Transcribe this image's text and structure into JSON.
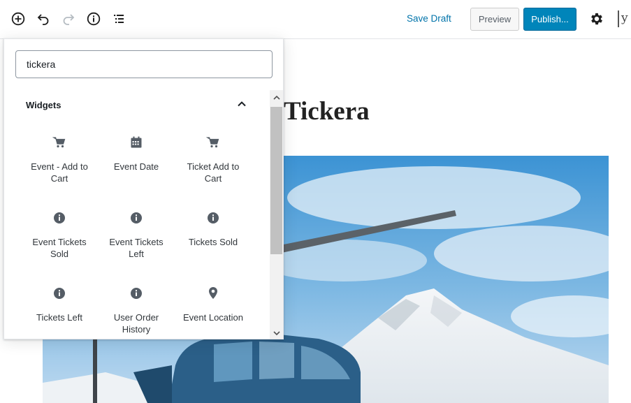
{
  "toolbar": {
    "add_block_icon": "plus-circle-icon",
    "undo_icon": "undo-icon",
    "redo_icon": "redo-icon",
    "info_icon": "info-icon",
    "outline_icon": "list-view-icon",
    "save_draft": "Save Draft",
    "preview": "Preview",
    "publish": "Publish...",
    "settings_icon": "gear-icon",
    "yoast_icon": "yoast-icon",
    "yoast_glyph": "y"
  },
  "editor": {
    "title": "Tickera"
  },
  "inserter": {
    "search_value": "tickera",
    "section_title": "Widgets",
    "items": [
      {
        "label": "Event - Add to Cart",
        "icon": "cart-icon"
      },
      {
        "label": "Event Date",
        "icon": "calendar-icon"
      },
      {
        "label": "Ticket Add to Cart",
        "icon": "cart-icon"
      },
      {
        "label": "Event Tickets Sold",
        "icon": "info-icon"
      },
      {
        "label": "Event Tickets Left",
        "icon": "info-icon"
      },
      {
        "label": "Tickets Sold",
        "icon": "info-icon"
      },
      {
        "label": "Tickets Left",
        "icon": "info-icon"
      },
      {
        "label": "User Order History",
        "icon": "info-icon"
      },
      {
        "label": "Event Location",
        "icon": "location-pin-icon"
      }
    ]
  },
  "colors": {
    "accent": "#0085ba",
    "link": "#0073aa",
    "icon": "#555d66"
  }
}
